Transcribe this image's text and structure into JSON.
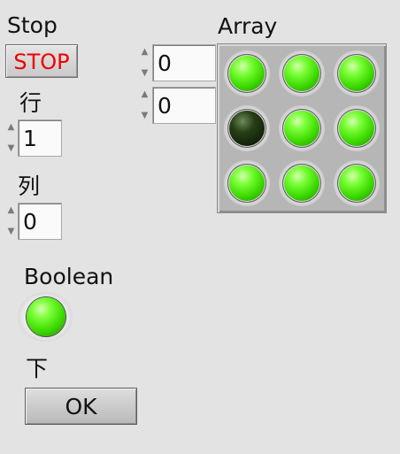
{
  "stop": {
    "label": "Stop",
    "button_label": "STOP"
  },
  "row_control": {
    "label": "行",
    "value": "1"
  },
  "col_control": {
    "label": "列",
    "value": "0"
  },
  "array": {
    "label": "Array",
    "index_0": "0",
    "index_1": "0",
    "leds": [
      [
        true,
        true,
        true
      ],
      [
        false,
        true,
        true
      ],
      [
        true,
        true,
        true
      ]
    ]
  },
  "boolean": {
    "label": "Boolean",
    "state": true
  },
  "down": {
    "label": "下",
    "button_label": "OK"
  },
  "colors": {
    "led_on": "#3edb00",
    "led_off": "#1a2e0e",
    "stop_text": "#ee0000",
    "background": "#e3e3e3"
  }
}
